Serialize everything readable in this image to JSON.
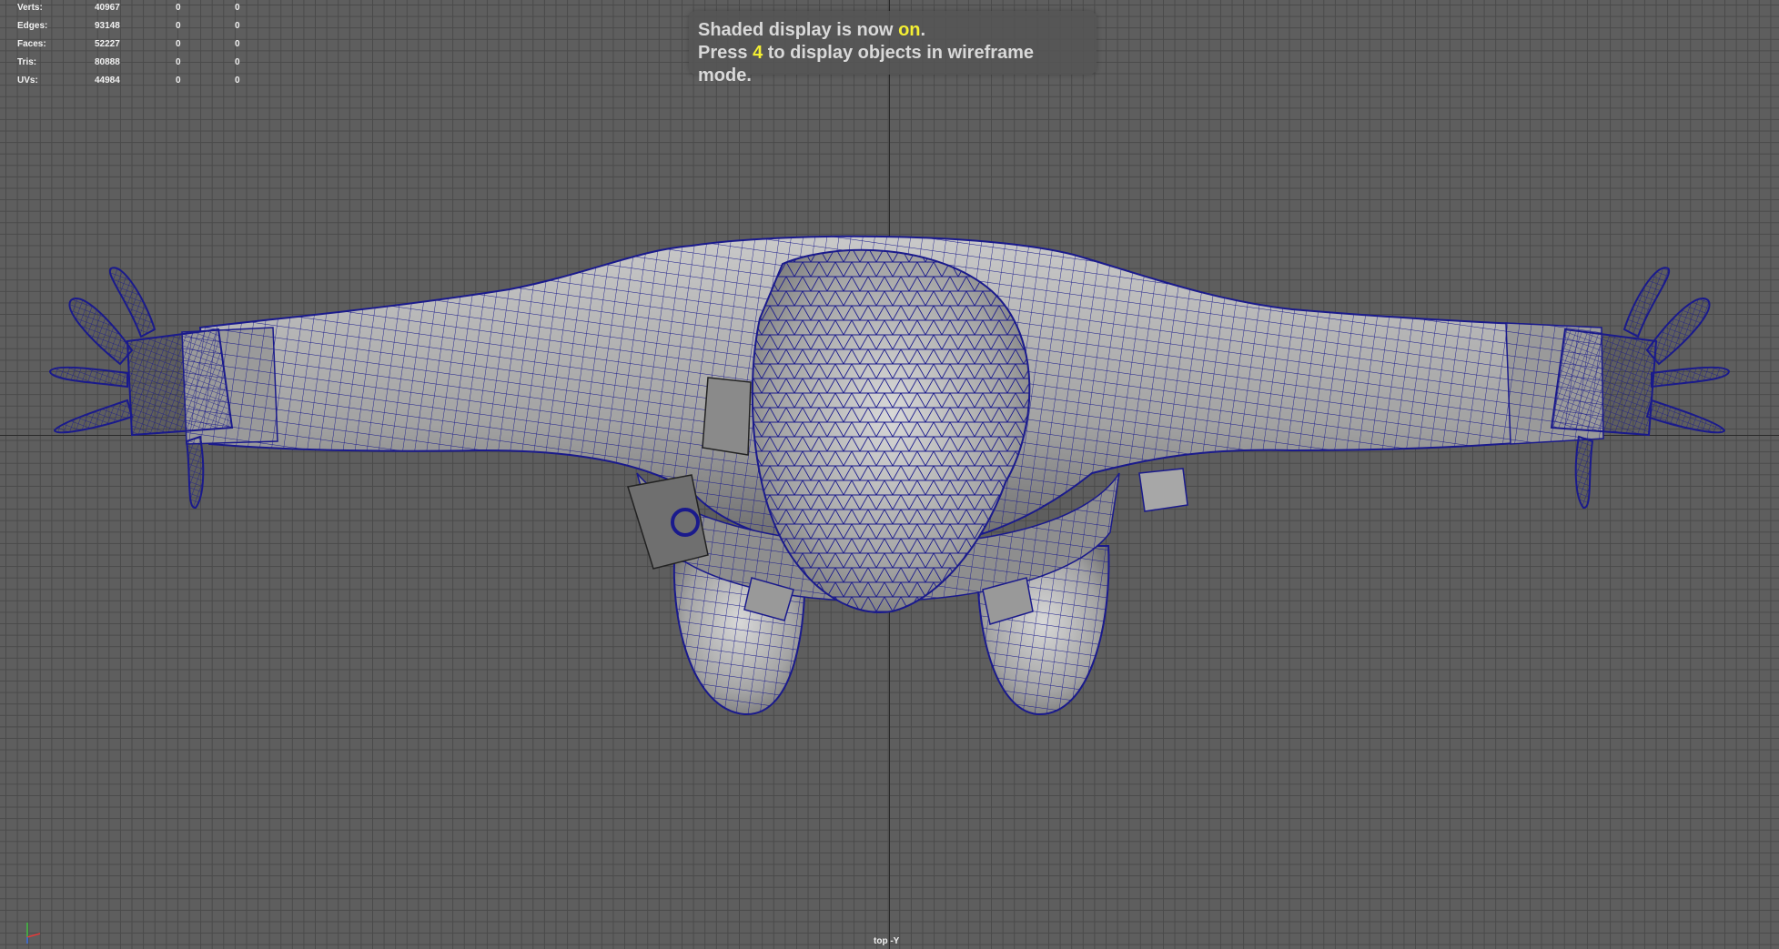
{
  "hud": {
    "rows": [
      {
        "label": "Verts:",
        "v1": "40967",
        "v2": "0",
        "v3": "0"
      },
      {
        "label": "Edges:",
        "v1": "93148",
        "v2": "0",
        "v3": "0"
      },
      {
        "label": "Faces:",
        "v1": "52227",
        "v2": "0",
        "v3": "0"
      },
      {
        "label": "Tris:",
        "v1": "80888",
        "v2": "0",
        "v3": "0"
      },
      {
        "label": "UVs:",
        "v1": "44984",
        "v2": "0",
        "v3": "0"
      }
    ]
  },
  "message": {
    "line1_pre": "Shaded display is now ",
    "line1_hl": "on",
    "line1_post": ".",
    "line2_pre": "Press ",
    "line2_hl": "4",
    "line2_post": " to display objects in wireframe mode."
  },
  "viewport": {
    "camera_label": "top -Y"
  },
  "colors": {
    "background": "#5e5e5e",
    "grid_line": "#4a4a4a",
    "wireframe": "#1a1a8c",
    "highlight": "#f4ef33",
    "mesh_shade": "#a8a8a8"
  },
  "icons": {
    "axis_gizmo": "xyz-axis-icon"
  }
}
